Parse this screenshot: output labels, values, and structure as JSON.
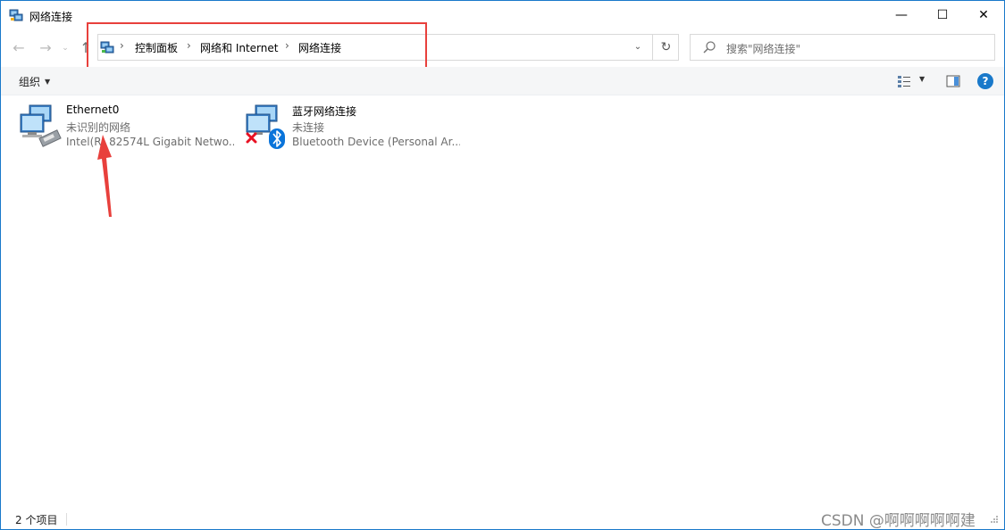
{
  "window": {
    "title": "网络连接",
    "minimize_glyph": "—",
    "maximize_glyph": "☐",
    "close_glyph": "✕"
  },
  "nav": {
    "back_glyph": "←",
    "forward_glyph": "→",
    "recent_glyph": "⌄",
    "up_glyph": "↑"
  },
  "address": {
    "breadcrumbs": [
      "控制面板",
      "网络和 Internet",
      "网络连接"
    ],
    "separator": "›",
    "dropdown_glyph": "⌄",
    "refresh_glyph": "↻"
  },
  "search": {
    "placeholder": "搜索\"网络连接\""
  },
  "commandbar": {
    "organize_label": "组织",
    "caret": "▼",
    "help_label": "?"
  },
  "connections": [
    {
      "name": "Ethernet0",
      "status": "未识别的网络",
      "device": "Intel(R) 82574L Gigabit Netwo...",
      "icon": "ethernet-adapter-icon"
    },
    {
      "name": "蓝牙网络连接",
      "status": "未连接",
      "device": "Bluetooth Device (Personal Ar...",
      "icon": "bluetooth-adapter-icon"
    }
  ],
  "statusbar": {
    "item_count": "2 个项目"
  },
  "watermark": "CSDN @啊啊啊啊啊建",
  "colors": {
    "accent": "#1979ca",
    "highlight_box": "#e8403c",
    "disconnected_x": "#e81123",
    "bluetooth": "#0a74da"
  }
}
